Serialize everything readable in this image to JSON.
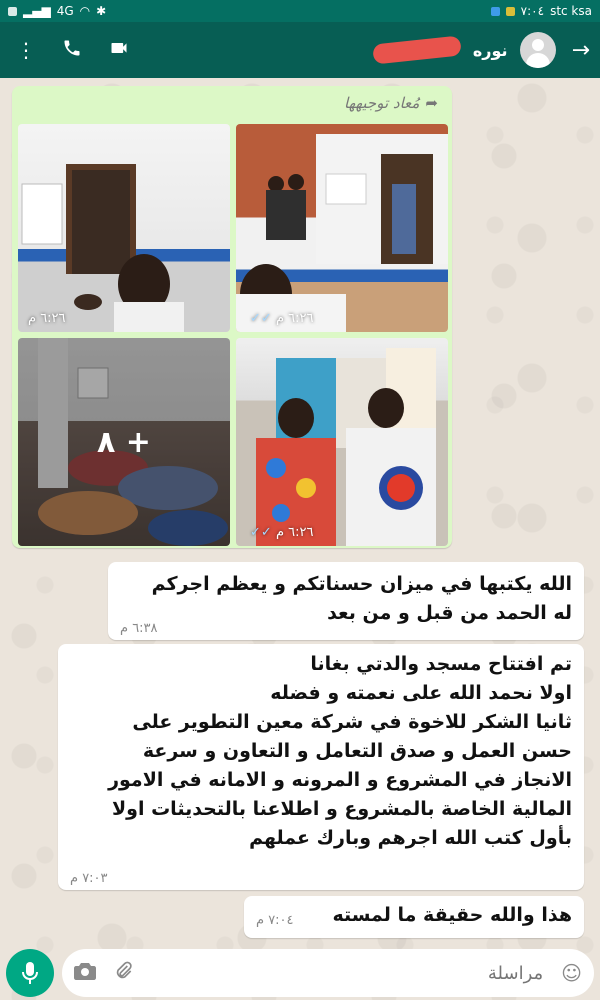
{
  "status": {
    "time": "٧:٠٤",
    "carrier": "stc ksa",
    "left_text": "4G"
  },
  "header": {
    "contact_name": "نوره"
  },
  "forwarded": {
    "label": "مُعاد توجيهها",
    "photos": [
      {
        "time": "٦:٢٦ م",
        "ticks": ""
      },
      {
        "time": "٦:٢٦ م",
        "ticks": "✓✓"
      },
      {
        "time": "",
        "more": "+ ٨"
      },
      {
        "time": "٦:٢٦ م",
        "ticks": "✓✓"
      }
    ]
  },
  "messages": [
    {
      "text": "الله يكتبها في ميزان حسناتكم و يعظم اجركم\nله الحمد من قبل و من بعد",
      "time": "٦:٣٨ م"
    },
    {
      "text": "تم افتتاح مسجد والدتي بغانا\nاولا نحمد الله على نعمته و فضله\nثانيا الشكر  للاخوة في شركة معين التطوير على\nحسن العمل و صدق التعامل و التعاون و سرعة\nالانجاز في المشروع و المرونه و الامانه في الامور\nالمالية الخاصة بالمشروع و اطلاعنا بالتحديثات اولا\nبأول كتب الله اجرهم وبارك عملهم",
      "time": "٧:٠٣ م"
    },
    {
      "text": "هذا والله حقيقة ما لمسته",
      "time": "٧:٠٤ م"
    }
  ],
  "composer": {
    "placeholder": "مراسلة"
  },
  "colors": {
    "header": "#075e54",
    "bubble_out": "#dcf8c6",
    "accent": "#00a884"
  }
}
